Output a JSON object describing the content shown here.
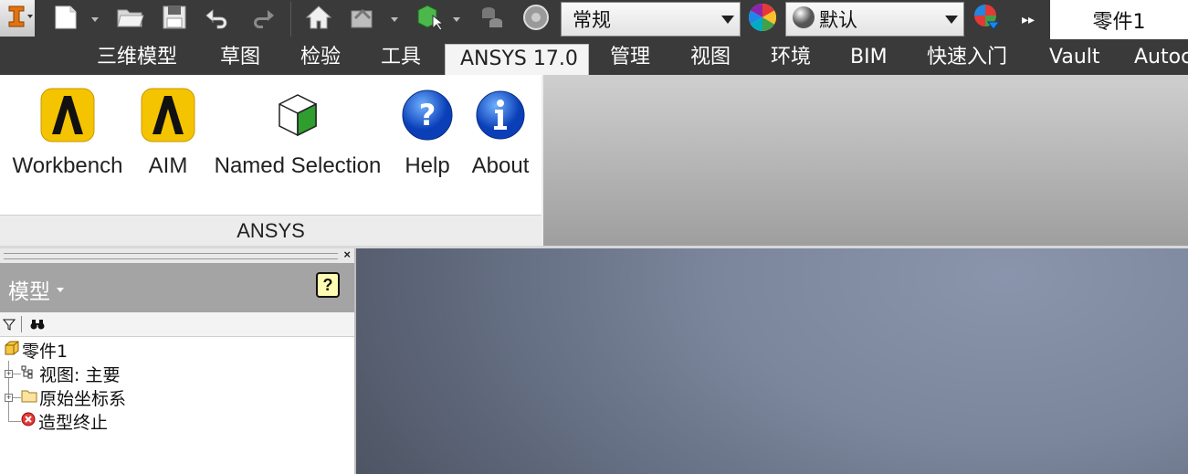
{
  "quick_access": {
    "app_button_icon": "inventor-app-icon",
    "icons": [
      "new-file-icon",
      "open-folder-icon",
      "save-icon",
      "undo-icon",
      "redo-icon",
      "home-icon",
      "update-icon",
      "select-box-icon",
      "parameters-icon",
      "appearance-icon",
      "color-wheel-icon",
      "material-sphere-icon",
      "clear-appearance-icon",
      "more-icon"
    ],
    "appearance_combo": "常规",
    "material_combo": "默认",
    "document_title": "零件1"
  },
  "ribbon_tabs": [
    "三维模型",
    "草图",
    "检验",
    "工具",
    "ANSYS 17.0",
    "管理",
    "视图",
    "环境",
    "BIM",
    "快速入门",
    "Vault",
    "Autoc"
  ],
  "active_tab_index": 4,
  "ribbon_panel": {
    "label": "ANSYS",
    "buttons": [
      {
        "label": "Workbench",
        "icon": "workbench-icon"
      },
      {
        "label": "AIM",
        "icon": "aim-icon"
      },
      {
        "label": "Named Selection",
        "icon": "named-selection-icon"
      },
      {
        "label": "Help",
        "icon": "help-icon"
      },
      {
        "label": "About",
        "icon": "about-icon"
      }
    ]
  },
  "browser": {
    "title": "模型",
    "close_glyph": "×",
    "help_glyph": "?",
    "tree": [
      {
        "label": "零件1",
        "icon": "part-icon"
      },
      {
        "label": "视图: 主要",
        "icon": "view-rep-icon"
      },
      {
        "label": "原始坐标系",
        "icon": "folder-icon"
      },
      {
        "label": "造型终止",
        "icon": "end-of-part-icon"
      }
    ]
  },
  "colors": {
    "toolbar_bg": "#3a3a3a",
    "ansys_yellow": "#f5c400",
    "help_blue": "#1f5fd6",
    "viewport_top": "#8a95ac",
    "viewport_bottom": "#454b57"
  }
}
